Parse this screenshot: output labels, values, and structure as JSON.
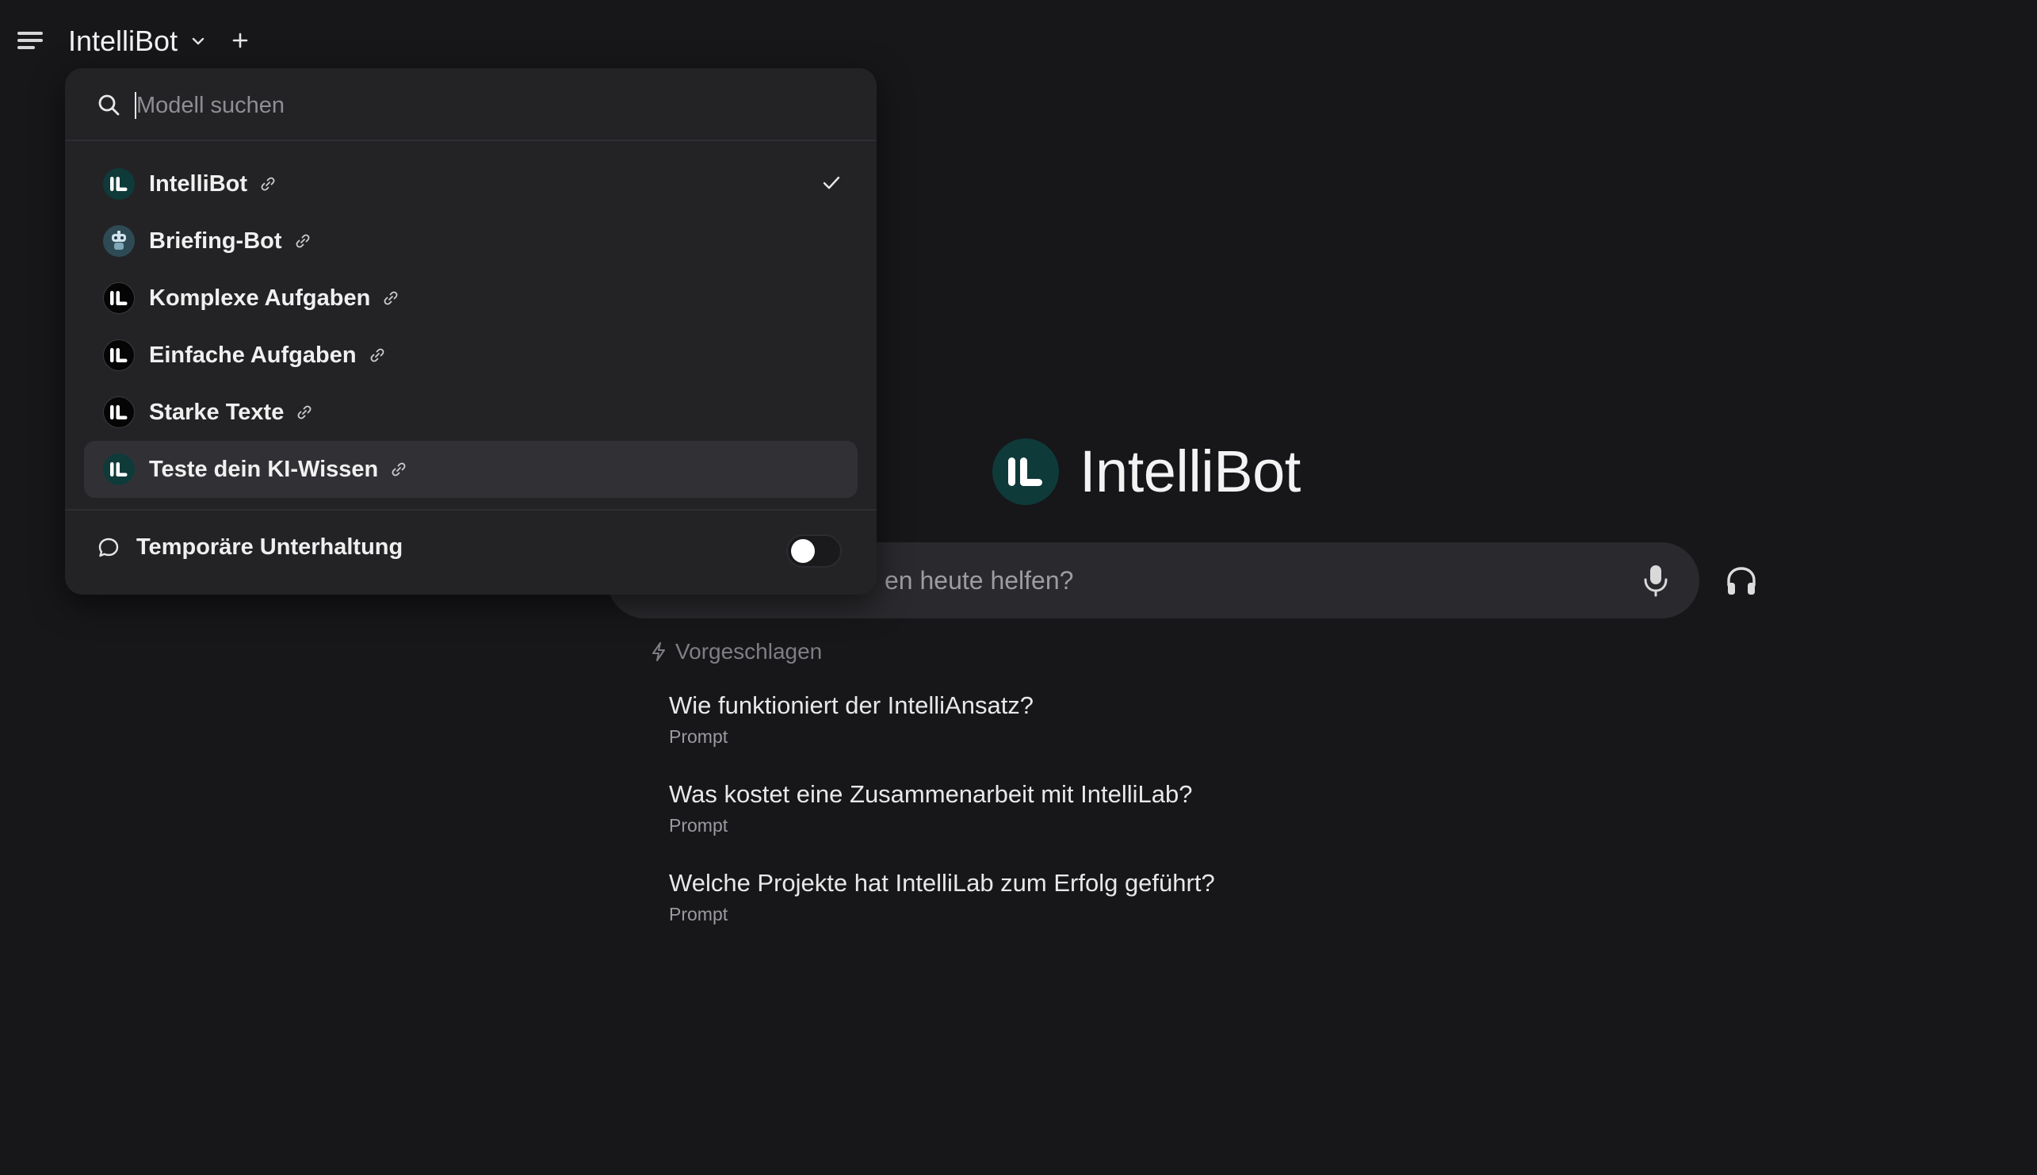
{
  "header": {
    "model_title": "IntelliBot"
  },
  "dropdown": {
    "search_placeholder": "Modell suchen",
    "models": [
      {
        "label": "IntelliBot",
        "selected": true,
        "avatar": "teal"
      },
      {
        "label": "Briefing-Bot",
        "selected": false,
        "avatar": "robot"
      },
      {
        "label": "Komplexe Aufgaben",
        "selected": false,
        "avatar": "black"
      },
      {
        "label": "Einfache Aufgaben",
        "selected": false,
        "avatar": "black"
      },
      {
        "label": "Starke Texte",
        "selected": false,
        "avatar": "black"
      },
      {
        "label": "Teste dein KI-Wissen",
        "selected": false,
        "avatar": "teal",
        "hovered": true
      }
    ],
    "temporary_chat_label": "Temporäre Unterhaltung",
    "temporary_chat_enabled": false
  },
  "hero": {
    "title": "IntelliBot"
  },
  "chat": {
    "visible_placeholder_fragment": "en heute helfen?"
  },
  "suggestions": {
    "heading": "Vorgeschlagen",
    "items": [
      {
        "question": "Wie funktioniert der IntelliAnsatz?",
        "type": "Prompt"
      },
      {
        "question": "Was kostet eine Zusammenarbeit mit IntelliLab?",
        "type": "Prompt"
      },
      {
        "question": "Welche Projekte hat IntelliLab zum Erfolg geführt?",
        "type": "Prompt"
      }
    ]
  },
  "colors": {
    "background": "#171619",
    "panel": "#232326",
    "accent_teal": "#0f3a3a"
  },
  "icons": [
    "menu-icon",
    "chevron-down-icon",
    "plus-icon",
    "search-icon",
    "link-icon",
    "check-icon",
    "chat-bubble-icon",
    "microphone-icon",
    "headphones-icon",
    "lightning-icon"
  ]
}
